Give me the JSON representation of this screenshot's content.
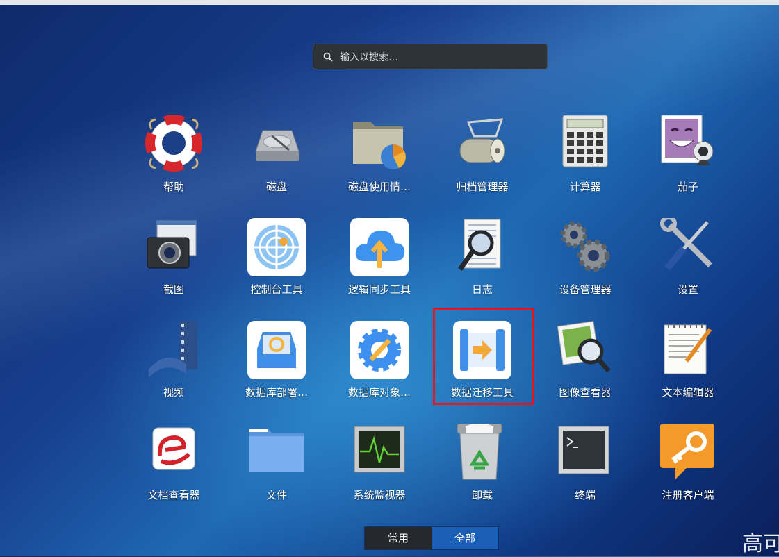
{
  "search": {
    "placeholder": "输入以搜索…"
  },
  "apps": [
    {
      "label": "帮助",
      "icon": "lifebuoy-icon"
    },
    {
      "label": "磁盘",
      "icon": "disk-icon"
    },
    {
      "label": "磁盘使用情…",
      "icon": "disk-usage-icon"
    },
    {
      "label": "归档管理器",
      "icon": "archive-manager-icon"
    },
    {
      "label": "计算器",
      "icon": "calculator-icon"
    },
    {
      "label": "茄子",
      "icon": "cheese-webcam-icon"
    },
    {
      "label": "截图",
      "icon": "screenshot-camera-icon"
    },
    {
      "label": "控制台工具",
      "icon": "console-radar-icon"
    },
    {
      "label": "逻辑同步工具",
      "icon": "cloud-upload-icon"
    },
    {
      "label": "日志",
      "icon": "log-magnifier-icon"
    },
    {
      "label": "设备管理器",
      "icon": "gears-icon"
    },
    {
      "label": "设置",
      "icon": "wrench-screwdriver-icon"
    },
    {
      "label": "视频",
      "icon": "video-film-icon"
    },
    {
      "label": "数据库部署…",
      "icon": "database-deploy-icon"
    },
    {
      "label": "数据库对象…",
      "icon": "database-object-gear-icon"
    },
    {
      "label": "数据迁移工具",
      "icon": "data-migration-icon"
    },
    {
      "label": "图像查看器",
      "icon": "image-viewer-icon"
    },
    {
      "label": "文本编辑器",
      "icon": "text-editor-icon"
    },
    {
      "label": "文档查看器",
      "icon": "document-viewer-icon"
    },
    {
      "label": "文件",
      "icon": "folder-icon"
    },
    {
      "label": "系统监视器",
      "icon": "system-monitor-icon"
    },
    {
      "label": "卸载",
      "icon": "recycle-bin-icon"
    },
    {
      "label": "终端",
      "icon": "terminal-icon"
    },
    {
      "label": "注册客户端",
      "icon": "key-register-icon"
    }
  ],
  "tabs": [
    {
      "label": "常用",
      "selected": false
    },
    {
      "label": "全部",
      "selected": true
    }
  ],
  "watermark": "高可",
  "colors": {
    "highlight": "#e8141c",
    "selected_tab": "#1c5fb7",
    "search_bg": "#2e3338"
  }
}
